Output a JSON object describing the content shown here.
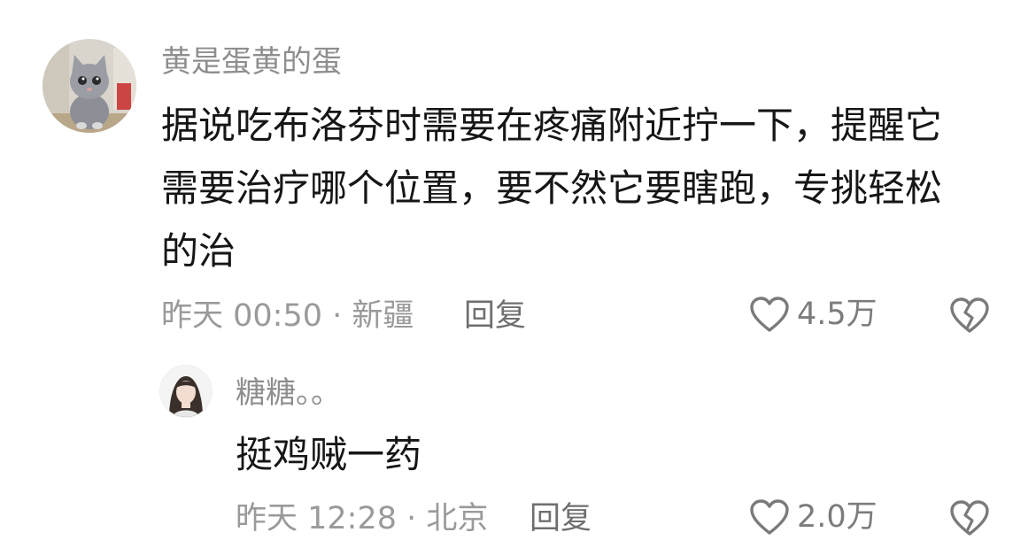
{
  "comments": [
    {
      "username": "黄是蛋黄的蛋",
      "text_lines": [
        "据说吃布洛芬时需要在疼痛附近拧一下，提醒它",
        "需要治疗哪个位置，要不然它要瞎跑，专挑轻松",
        "的治"
      ],
      "time_location": "昨天 00:50 · 新疆",
      "reply_label": "回复",
      "like_count": "4.5万",
      "avatar_icon": "cat-avatar"
    },
    {
      "username": "糖糖。。",
      "text_lines": [
        "挺鸡贼一药"
      ],
      "time_location": "昨天 12:28 · 北京",
      "reply_label": "回复",
      "like_count": "2.0万",
      "avatar_icon": "girl-avatar"
    }
  ],
  "colors": {
    "username": "#8e8e8e",
    "text": "#161616",
    "meta": "#9a9a9a",
    "icon": "#7a7a7a"
  }
}
